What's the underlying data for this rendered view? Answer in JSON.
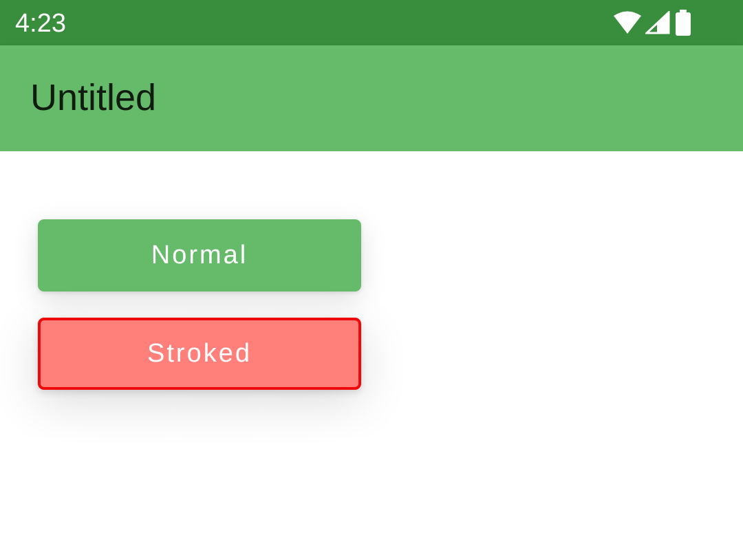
{
  "status_bar": {
    "time": "4:23",
    "icons": [
      "wifi-icon",
      "cellular-signal-icon",
      "battery-icon"
    ],
    "color": "#388e3c"
  },
  "app_bar": {
    "title": "Untitled",
    "color": "#66bb6a"
  },
  "buttons": {
    "normal_label": "Normal",
    "stroked_label": "Stroked",
    "normal_color": "#66bb6a",
    "stroked_fill": "#ff7f7b",
    "stroked_border": "#ee0a0a"
  }
}
